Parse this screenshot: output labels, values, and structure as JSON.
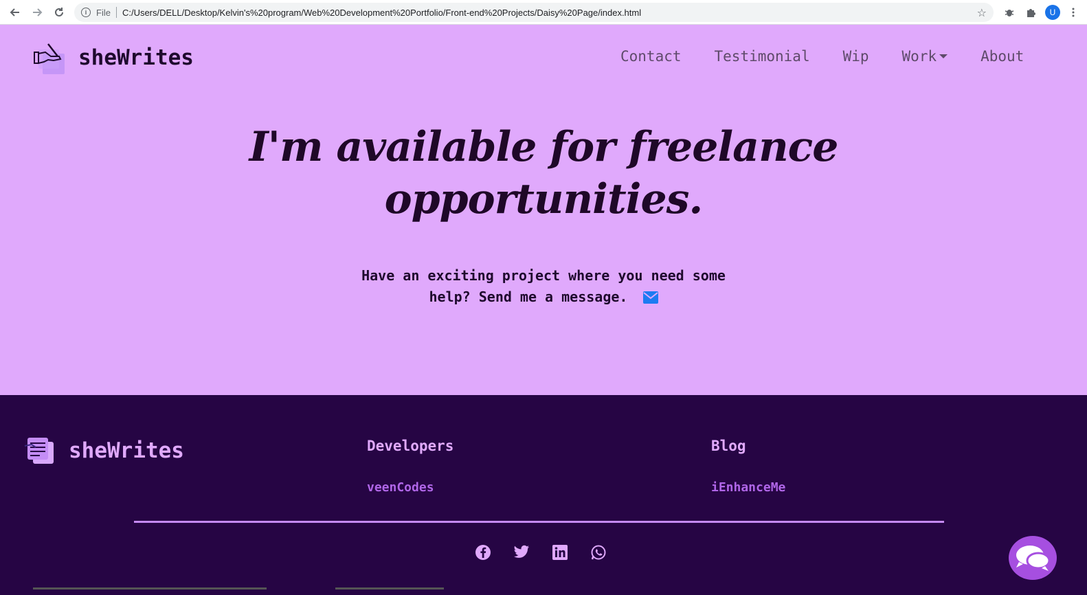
{
  "browser": {
    "back_icon": "arrow-left-icon",
    "forward_icon": "arrow-right-icon",
    "reload_icon": "reload-icon",
    "scheme_label": "File",
    "url": "C:/Users/DELL/Desktop/Kelvin's%20program/Web%20Development%20Portfolio/Front-end%20Projects/Daisy%20Page/index.html",
    "profile_initial": "U"
  },
  "header": {
    "brand": "sheWrites",
    "nav": [
      {
        "label": "Contact"
      },
      {
        "label": "Testimonial"
      },
      {
        "label": "Wip"
      },
      {
        "label": "Work",
        "dropdown": true
      },
      {
        "label": "About"
      }
    ]
  },
  "hero": {
    "headline_line1": "I'm available for freelance",
    "headline_line2": "opportunities.",
    "subtext": "Have an exciting project where you need some help? Send me a message."
  },
  "footer": {
    "brand": "sheWrites",
    "columns": [
      {
        "title": "Developers",
        "link": "veenCodes"
      },
      {
        "title": "Blog",
        "link": "iEnhanceMe"
      }
    ],
    "socials": [
      "facebook-icon",
      "twitter-icon",
      "linkedin-icon",
      "whatsapp-icon"
    ]
  },
  "colors": {
    "hero_bg": "#e0a9fc",
    "footer_bg": "#260544",
    "accent": "#b066e8",
    "mail_icon": "#1e7bf2"
  }
}
